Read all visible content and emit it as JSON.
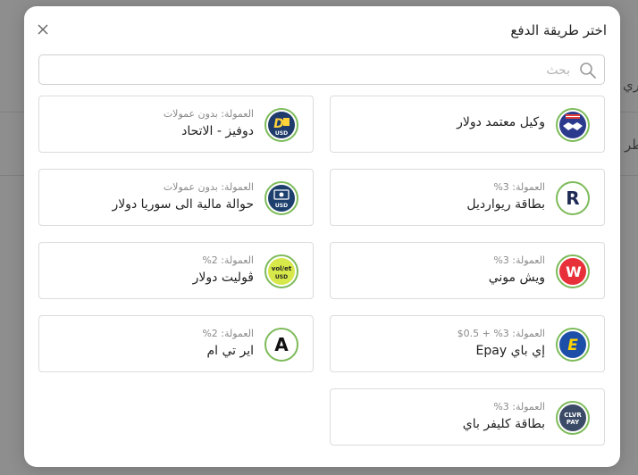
{
  "background_page": {
    "label_1": "طري",
    "label_2": "طر"
  },
  "modal": {
    "title": "اختر طريقة الدفع",
    "close_icon": "close-icon",
    "search": {
      "placeholder": "بحث",
      "value": "",
      "icon": "search-icon"
    }
  },
  "methods": [
    {
      "name": "وكيل معتمد دولار",
      "fee": "",
      "logo": "handshake-agent-logo",
      "logo_bg": "#2b3a8c"
    },
    {
      "name": "دوفيز - الاتحاد",
      "fee": "العمولة: بدون عمولات",
      "logo": "dofiz-usd-logo",
      "logo_bg": "#1f3b6b",
      "logo_text_1": "D",
      "logo_text_2": "USD"
    },
    {
      "name": "بطاقة ريوارديل",
      "fee": "العمولة: 3%",
      "logo": "rewardble-logo",
      "logo_bg": "#1f2a55",
      "logo_text_1": "R"
    },
    {
      "name": "حوالة مالية الى سوريا دولار",
      "fee": "العمولة: بدون عمولات",
      "logo": "syria-transfer-usd-logo",
      "logo_bg": "#1d3f6e",
      "logo_text_1": "USD"
    },
    {
      "name": "ويش موني",
      "fee": "العمولة: 3%",
      "logo": "wish-money-logo",
      "logo_bg": "#e8303a",
      "logo_text_1": "W"
    },
    {
      "name": "ڤوليت دولار",
      "fee": "العمولة: 2%",
      "logo": "volet-usd-logo",
      "logo_bg": "#d6e84a",
      "logo_text_1": "vol/et",
      "logo_text_2": "USD"
    },
    {
      "name": "إي باي Epay",
      "fee": "العمولة: 3% + 0.5$",
      "logo": "epay-logo",
      "logo_bg": "#1e4fa8",
      "logo_text_1": "E"
    },
    {
      "name": "اير تي ام",
      "fee": "العمولة: 2%",
      "logo": "airtm-logo",
      "logo_bg": "#ffffff",
      "logo_text_1": "A"
    },
    {
      "name": "بطاقة كليفر باي",
      "fee": "العمولة: 3%",
      "logo": "clever-pay-logo",
      "logo_bg": "#3b4a66",
      "logo_text_1": "CLVR",
      "logo_text_2": "PAY"
    }
  ]
}
